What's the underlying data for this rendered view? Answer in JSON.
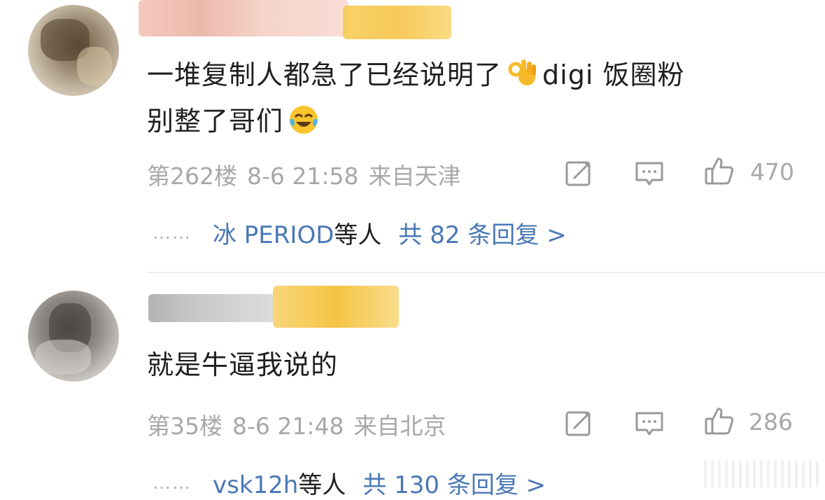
{
  "comments": [
    {
      "text_line1": "一堆复制人都急了已经说明了",
      "text_line1_emoji": "ok-hand-emoji",
      "text_line1_after": "digi 饭圈粉",
      "text_line2": "别整了哥们",
      "text_line2_emoji": "crying-laughing-emoji",
      "floor": "第262楼",
      "time": "8-6 21:58",
      "location": "来自天津",
      "like_count": "470",
      "reply_names": "冰 PERIOD",
      "reply_suffix": "等人",
      "reply_total": "共 82 条回复 >",
      "reply_ellipsis": "……"
    },
    {
      "text_line1": "就是牛逼我说的",
      "floor": "第35楼",
      "time": "8-6 21:48",
      "location": "来自北京",
      "like_count": "286",
      "reply_names": "vsk12h",
      "reply_suffix": "等人",
      "reply_total": "共 130 条回复 >",
      "reply_ellipsis": "……"
    }
  ],
  "icons": {
    "edit": "edit-icon",
    "reply": "reply-icon",
    "like": "like-icon"
  },
  "colors": {
    "link": "#4a78b5",
    "meta": "#a8a8a8",
    "text": "#1f1f1f"
  }
}
